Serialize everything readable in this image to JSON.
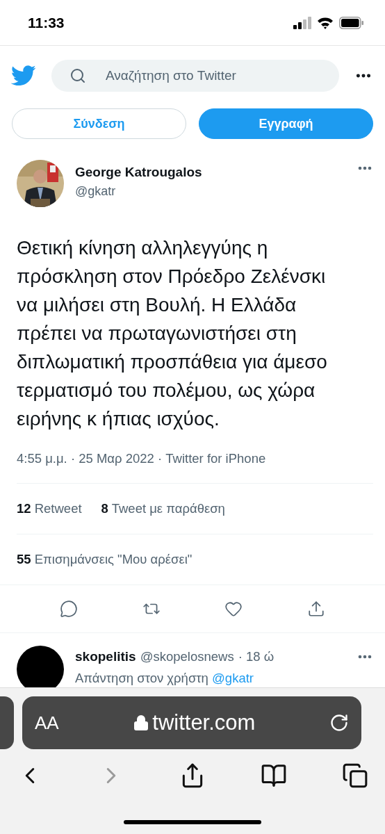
{
  "status_bar": {
    "time": "11:33"
  },
  "header": {
    "search": {
      "placeholder": "Αναζήτηση στο Twitter"
    }
  },
  "auth_buttons": [
    {
      "label": "Σύνδεση",
      "kind": "outline"
    },
    {
      "label": "Εγγραφή",
      "kind": "filled"
    }
  ],
  "tweet": {
    "author": {
      "name": "George Katrougalos",
      "handle": "@gkatr"
    },
    "text": "Θετική κίνηση αλληλεγγύης η πρόσκληση στον Πρόεδρο Ζελένσκι να μιλήσει στη Βουλή. Η Ελλάδα πρέπει να πρωταγωνιστήσει στη διπλωματική προσπάθεια για άμεσο τερματισμό του πολέμου, ως χώρα ειρήνης κ ήπιας ισχύος.",
    "meta": "4:55 μ.μ. · 25 Μαρ 2022 · Twitter for iPhone",
    "stats": [
      {
        "count": "12",
        "label": "Retweet"
      },
      {
        "count": "8",
        "label": "Tweet με παράθεση"
      }
    ],
    "likes": {
      "count": "55",
      "label": "Επισημάνσεις \"Μου αρέσει\""
    },
    "actions": [
      {
        "kind": "reply"
      },
      {
        "kind": "retweet"
      },
      {
        "kind": "like"
      },
      {
        "kind": "share"
      }
    ]
  },
  "reply": {
    "name": "skopelitis",
    "handle": "@skopelosnews",
    "time": "· 18 ώ",
    "context": "Απάντηση στον χρήστη",
    "mention": "@gkatr"
  },
  "browser": {
    "text_size": "AA",
    "url": "twitter.com",
    "toolbar": [
      {
        "kind": "back",
        "disabled": false
      },
      {
        "kind": "forward",
        "disabled": true
      },
      {
        "kind": "share",
        "disabled": false
      },
      {
        "kind": "bookmarks",
        "disabled": false
      },
      {
        "kind": "tabs",
        "disabled": false
      }
    ]
  }
}
